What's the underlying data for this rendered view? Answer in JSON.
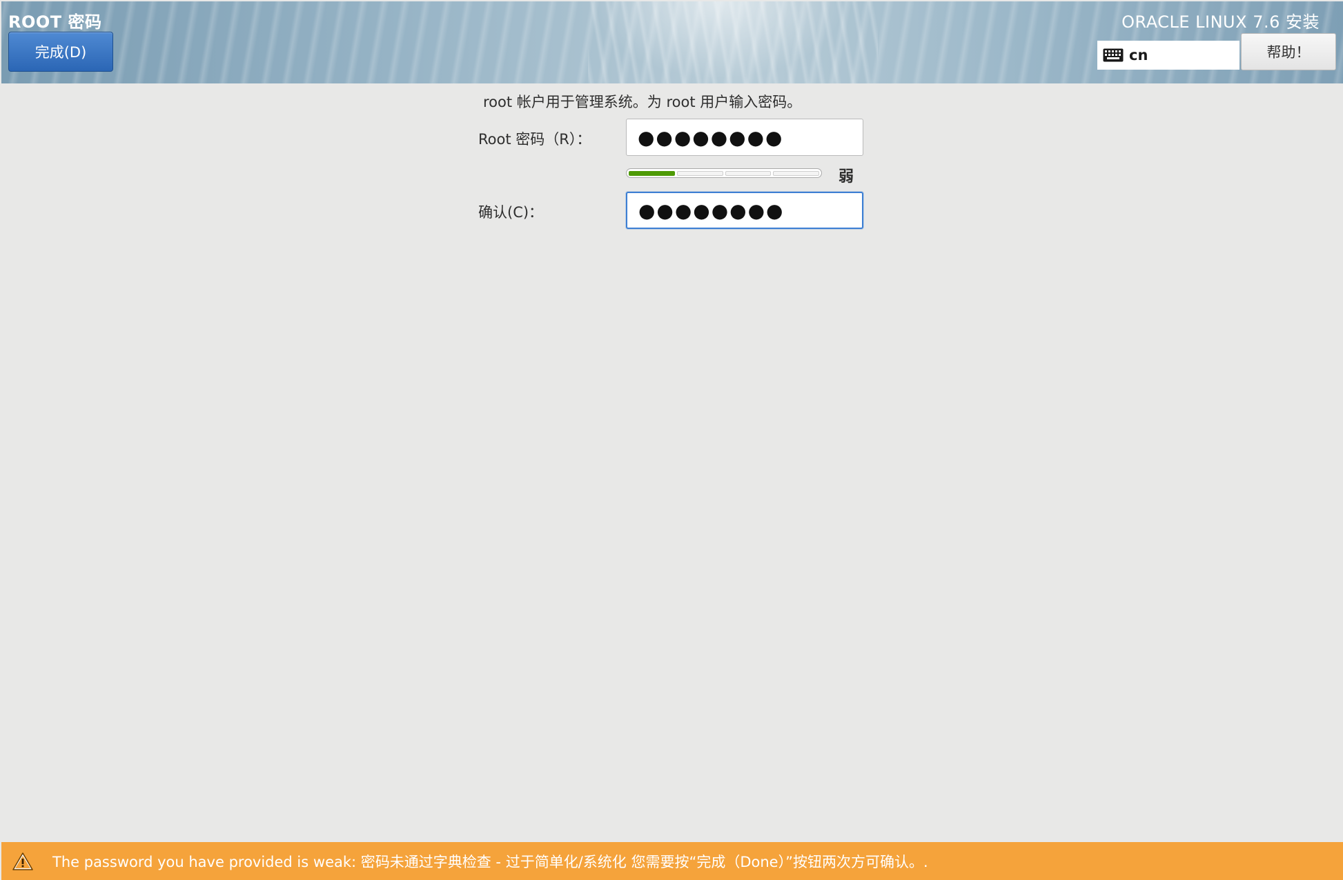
{
  "header": {
    "spoke_title": "ROOT 密码",
    "done_label": "完成(D)",
    "product_title": "ORACLE LINUX 7.6 安装",
    "keyboard_layout": "cn",
    "help_label": "帮助！"
  },
  "form": {
    "intro": "root 帐户用于管理系统。为 root 用户输入密码。",
    "root_password_label": "Root 密码（R）：",
    "root_password_value": "●●●●●●●●",
    "strength": {
      "level": 1,
      "max": 4,
      "label": "弱",
      "color": "#4e9a06"
    },
    "confirm_label": "确认(C)：",
    "confirm_password_value": "●●●●●●●●"
  },
  "warning": {
    "text": "The password you have provided is weak: 密码未通过字典检查 - 过于简单化/系统化 您需要按“完成（Done）”按钮两次方可确认。.",
    "color": "#f5a33b",
    "icon": "warning-icon"
  },
  "colors": {
    "accent": "#3d7fd3",
    "done_button": "#2b66b5",
    "background": "#e8e8e7"
  }
}
